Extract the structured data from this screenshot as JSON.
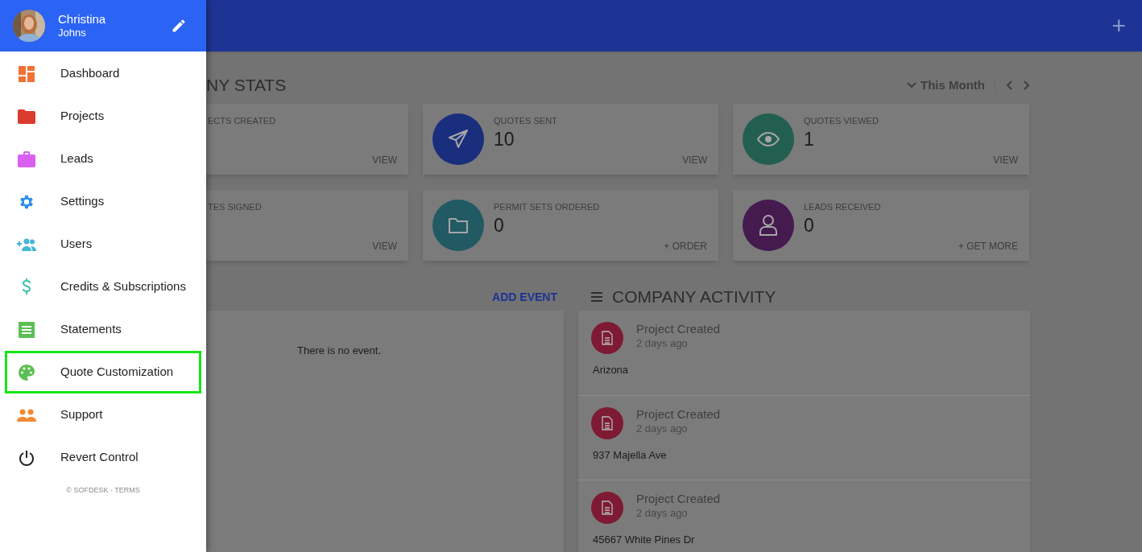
{
  "drawer": {
    "user": {
      "first_name": "Christina",
      "last_name": "Johns"
    },
    "items": [
      {
        "label": "Dashboard",
        "highlighted": false
      },
      {
        "label": "Projects",
        "highlighted": false
      },
      {
        "label": "Leads",
        "highlighted": false
      },
      {
        "label": "Settings",
        "highlighted": false
      },
      {
        "label": "Users",
        "highlighted": false
      },
      {
        "label": "Credits & Subscriptions",
        "highlighted": false
      },
      {
        "label": "Statements",
        "highlighted": false
      },
      {
        "label": "Quote Customization",
        "highlighted": true
      },
      {
        "label": "Support",
        "highlighted": false
      },
      {
        "label": "Revert Control",
        "highlighted": false
      }
    ],
    "footer": "© SOFDESK - TERMS"
  },
  "top_bar": {
    "add": "+"
  },
  "stats": {
    "title": "NY STATS",
    "period": "This Month",
    "cards": [
      {
        "label": "ECTS CREATED",
        "action": "VIEW"
      },
      {
        "label": "QUOTES SENT",
        "value": "10",
        "action": "VIEW",
        "color": "#1a2e7e"
      },
      {
        "label": "QUOTES VIEWED",
        "value": "1",
        "action": "VIEW",
        "color": "#235f50"
      },
      {
        "label": "TES SIGNED",
        "action": "VIEW"
      },
      {
        "label": "PERMIT SETS ORDERED",
        "value": "0",
        "action": "+ ORDER",
        "color": "#225a63"
      },
      {
        "label": "LEADS RECEIVED",
        "value": "0",
        "action": "+ GET MORE",
        "color": "#441a4f"
      }
    ]
  },
  "events": {
    "add": "ADD EVENT",
    "empty": "There is no event."
  },
  "activity": {
    "title": "COMPANY ACTIVITY",
    "items": [
      {
        "title": "Project Created",
        "time": "2 days ago",
        "detail": "Arizona"
      },
      {
        "title": "Project Created",
        "time": "2 days ago",
        "detail": "937 Majella Ave"
      },
      {
        "title": "Project Created",
        "time": "2 days ago",
        "detail": "45667 White Pines Dr"
      }
    ]
  }
}
